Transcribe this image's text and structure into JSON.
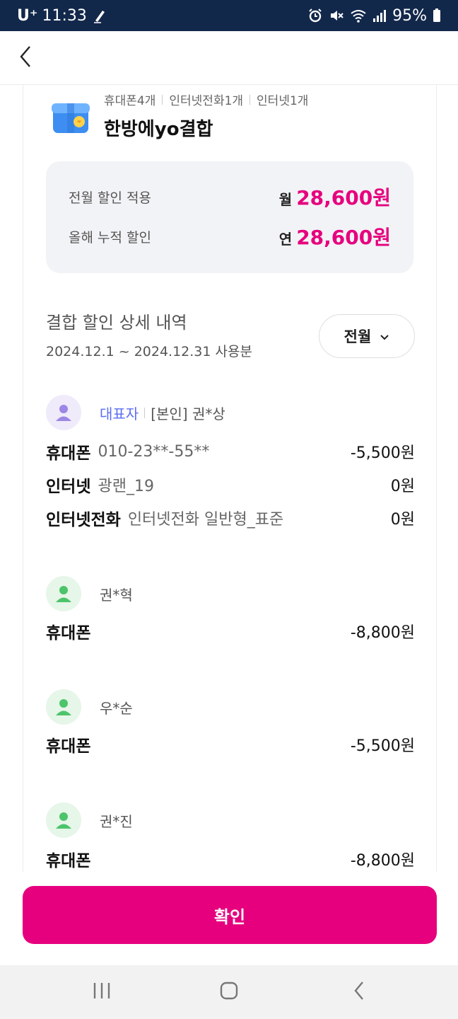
{
  "status_bar": {
    "carrier": "U⁺",
    "time": "11:33",
    "battery": "95%",
    "icons": [
      "pen-icon",
      "alarm-icon",
      "mute-icon",
      "wifi-icon",
      "signal-icon",
      "battery-icon"
    ]
  },
  "header": {
    "back_icon": "chevron-left-icon"
  },
  "combo": {
    "icon": "gift-box-icon",
    "counts": [
      "휴대폰4개",
      "인터넷전화1개",
      "인터넷1개"
    ],
    "title": "한방에yo결합"
  },
  "summary": {
    "rows": [
      {
        "label": "전월 할인 적용",
        "unit": "월",
        "value": "28,600원"
      },
      {
        "label": "올해 누적 할인",
        "unit": "연",
        "value": "28,600원"
      }
    ],
    "accent_color": "#e6007e"
  },
  "detail": {
    "title": "결합 할인 상세 내역",
    "period": "2024.12.1 ~ 2024.12.31 사용분",
    "month_select": {
      "value": "전월",
      "icon": "chevron-down-icon"
    }
  },
  "members": [
    {
      "role": "대표자",
      "name": "[본인] 권*상",
      "avatar_color": "purple",
      "services": [
        {
          "service": "휴대폰",
          "plan": "010-23**-55**",
          "price": "-5,500원"
        },
        {
          "service": "인터넷",
          "plan": "광랜_19",
          "price": "0원"
        },
        {
          "service": "인터넷전화",
          "plan": "인터넷전화 일반형_표준",
          "price": "0원"
        }
      ]
    },
    {
      "name": "권*혁",
      "avatar_color": "green",
      "services": [
        {
          "service": "휴대폰",
          "plan": "",
          "price": "-8,800원"
        }
      ]
    },
    {
      "name": "우*순",
      "avatar_color": "green",
      "services": [
        {
          "service": "휴대폰",
          "plan": "",
          "price": "-5,500원"
        }
      ]
    },
    {
      "name": "권*진",
      "avatar_color": "green",
      "services": [
        {
          "service": "휴대폰",
          "plan": "",
          "price": "-8,800원"
        }
      ]
    }
  ],
  "confirm_button": {
    "label": "확인",
    "color": "#e6007e"
  },
  "nav_bar": {
    "icons": [
      "recent-apps-icon",
      "home-icon",
      "back-icon"
    ]
  }
}
